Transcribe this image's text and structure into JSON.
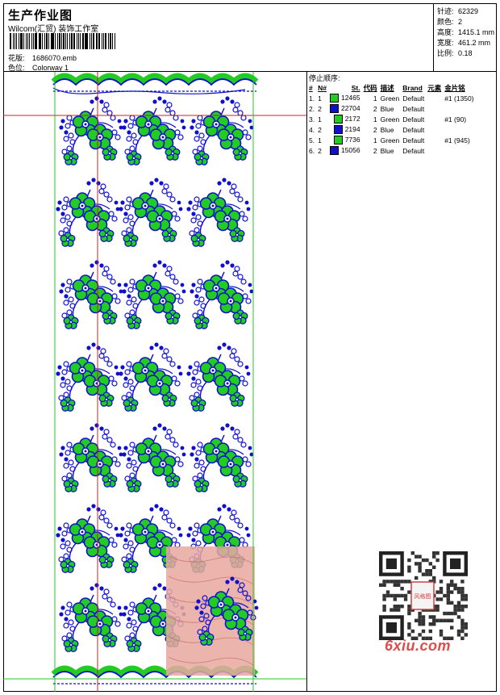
{
  "header": {
    "title": "生产作业图",
    "company": "Wilcom(汇贸) 装饰工作室",
    "design_label": "花版:",
    "design_value": "1686070.emb",
    "colorway_label": "色位:",
    "colorway_value": "Colorway 1"
  },
  "specs": [
    {
      "label": "针迹:",
      "value": "62329"
    },
    {
      "label": "颜色:",
      "value": "2"
    },
    {
      "label": "高度:",
      "value": "1415.1 mm"
    },
    {
      "label": "宽度:",
      "value": "461.2 mm"
    },
    {
      "label": "比例:",
      "value": "0.18"
    }
  ],
  "stop_sequence": {
    "title": "停止顺序:",
    "columns": [
      "#",
      "N#",
      "St.",
      "代码",
      "描述",
      "Brand",
      "元素",
      "金片铭"
    ],
    "rows": [
      {
        "idx": "1.",
        "n": "1",
        "color": "#22cc22",
        "st": "12465",
        "code": "1",
        "desc": "Green",
        "brand": "Default",
        "elem": "",
        "seq": "#1 (1350)"
      },
      {
        "idx": "2.",
        "n": "2",
        "color": "#1010cc",
        "st": "22704",
        "code": "2",
        "desc": "Blue",
        "brand": "Default",
        "elem": "",
        "seq": ""
      },
      {
        "idx": "3.",
        "n": "1",
        "color": "#22cc22",
        "st": "2172",
        "code": "1",
        "desc": "Green",
        "brand": "Default",
        "elem": "",
        "seq": "#1 (90)"
      },
      {
        "idx": "4.",
        "n": "2",
        "color": "#1010cc",
        "st": "2194",
        "code": "2",
        "desc": "Blue",
        "brand": "Default",
        "elem": "",
        "seq": ""
      },
      {
        "idx": "5.",
        "n": "1",
        "color": "#22cc22",
        "st": "7736",
        "code": "1",
        "desc": "Green",
        "brand": "Default",
        "elem": "",
        "seq": "#1 (945)"
      },
      {
        "idx": "6.",
        "n": "2",
        "color": "#1010cc",
        "st": "15056",
        "code": "2",
        "desc": "Blue",
        "brand": "Default",
        "elem": "",
        "seq": ""
      }
    ]
  },
  "watermark": {
    "text": "6xiu.com",
    "seal_text": "风格图"
  },
  "colors": {
    "thread_green": "#22cc22",
    "thread_blue": "#1010cc",
    "guide_red": "#cc2222",
    "guide_green": "#22cc22",
    "sample_pink": "#e8a8a0"
  }
}
